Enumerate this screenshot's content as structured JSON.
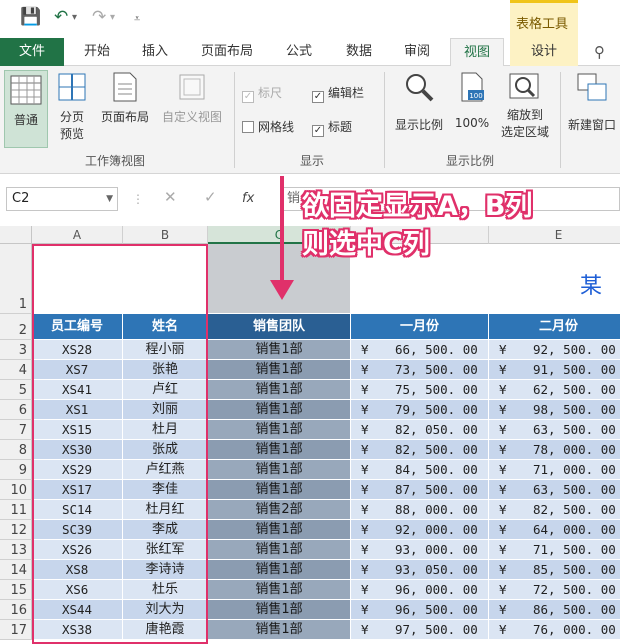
{
  "context_tab_group": "表格工具",
  "tabs": [
    "文件",
    "开始",
    "插入",
    "页面布局",
    "公式",
    "数据",
    "审阅",
    "视图",
    "设计"
  ],
  "ribbon": {
    "workbook_views": {
      "normal": "普通",
      "page_break_line1": "分页",
      "page_break_line2": "预览",
      "page_layout": "页面布局",
      "custom_views": "自定义视图",
      "group_label": "工作簿视图"
    },
    "show": {
      "ruler": "标尺",
      "formula_bar": "编辑栏",
      "gridlines": "网格线",
      "headings": "标题",
      "group_label": "显示"
    },
    "zoom": {
      "zoom": "显示比例",
      "hundred": "100%",
      "to_sel_line1": "缩放到",
      "to_sel_line2": "选定区域",
      "group_label": "显示比例",
      "badge": "100"
    },
    "window": {
      "new_window": "新建窗口"
    }
  },
  "formula_bar": {
    "name_box": "C2",
    "fx": "fx",
    "content": "销"
  },
  "columns": [
    "A",
    "B",
    "C",
    "D",
    "E"
  ],
  "rows": [
    "1",
    "2",
    "3",
    "4",
    "5",
    "6",
    "7",
    "8",
    "9",
    "10",
    "11",
    "12",
    "13",
    "14",
    "15",
    "16",
    "17"
  ],
  "sheet_title_partial": "某",
  "headers": {
    "a": "员工编号",
    "b": "姓名",
    "c": "销售团队",
    "d": "一月份",
    "e": "二月份"
  },
  "currency_symbol": "¥",
  "data": [
    {
      "id": "XS28",
      "name": "程小丽",
      "team": "销售1部",
      "jan": "66, 500. 00",
      "feb": "92, 500. 00"
    },
    {
      "id": "XS7",
      "name": "张艳",
      "team": "销售1部",
      "jan": "73, 500. 00",
      "feb": "91, 500. 00"
    },
    {
      "id": "XS41",
      "name": "卢红",
      "team": "销售1部",
      "jan": "75, 500. 00",
      "feb": "62, 500. 00"
    },
    {
      "id": "XS1",
      "name": "刘丽",
      "team": "销售1部",
      "jan": "79, 500. 00",
      "feb": "98, 500. 00"
    },
    {
      "id": "XS15",
      "name": "杜月",
      "team": "销售1部",
      "jan": "82, 050. 00",
      "feb": "63, 500. 00"
    },
    {
      "id": "XS30",
      "name": "张成",
      "team": "销售1部",
      "jan": "82, 500. 00",
      "feb": "78, 000. 00"
    },
    {
      "id": "XS29",
      "name": "卢红燕",
      "team": "销售1部",
      "jan": "84, 500. 00",
      "feb": "71, 000. 00"
    },
    {
      "id": "XS17",
      "name": "李佳",
      "team": "销售1部",
      "jan": "87, 500. 00",
      "feb": "63, 500. 00"
    },
    {
      "id": "SC14",
      "name": "杜月红",
      "team": "销售2部",
      "jan": "88, 000. 00",
      "feb": "82, 500. 00"
    },
    {
      "id": "SC39",
      "name": "李成",
      "team": "销售1部",
      "jan": "92, 000. 00",
      "feb": "64, 000. 00"
    },
    {
      "id": "XS26",
      "name": "张红军",
      "team": "销售1部",
      "jan": "93, 000. 00",
      "feb": "71, 500. 00"
    },
    {
      "id": "XS8",
      "name": "李诗诗",
      "team": "销售1部",
      "jan": "93, 050. 00",
      "feb": "85, 500. 00"
    },
    {
      "id": "XS6",
      "name": "杜乐",
      "team": "销售1部",
      "jan": "96, 000. 00",
      "feb": "72, 500. 00"
    },
    {
      "id": "XS44",
      "name": "刘大为",
      "team": "销售1部",
      "jan": "96, 500. 00",
      "feb": "86, 500. 00"
    },
    {
      "id": "XS38",
      "name": "唐艳霞",
      "team": "销售1部",
      "jan": "97, 500. 00",
      "feb": "76, 000. 00"
    }
  ],
  "annotation": {
    "line1": "欲固定显示A，B列",
    "line2": "则选中C列"
  },
  "colors": {
    "excel_green": "#217346",
    "header_blue": "#2e75b6",
    "annotation_pink": "#e0306a"
  }
}
